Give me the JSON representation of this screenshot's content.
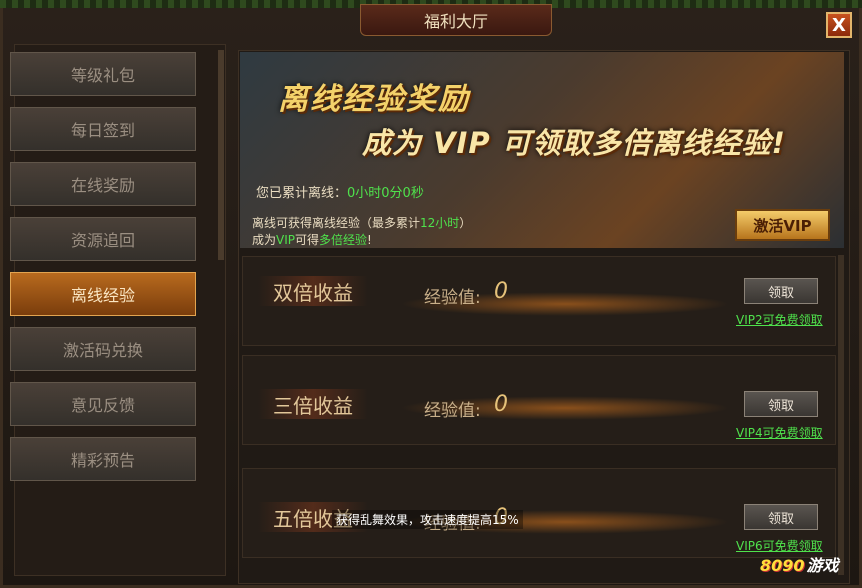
{
  "window": {
    "title": "福利大厅",
    "close_label": "X"
  },
  "sidebar": {
    "items": [
      {
        "label": "等级礼包",
        "active": false
      },
      {
        "label": "每日签到",
        "active": false
      },
      {
        "label": "在线奖励",
        "active": false
      },
      {
        "label": "资源追回",
        "active": false
      },
      {
        "label": "离线经验",
        "active": true
      },
      {
        "label": "激活码兑换",
        "active": false
      },
      {
        "label": "意见反馈",
        "active": false
      },
      {
        "label": "精彩预告",
        "active": false
      }
    ]
  },
  "banner": {
    "title": "离线经验奖励",
    "subtitle": "成为 VIP 可领取多倍离线经验!",
    "offline_label": "您已累计离线：",
    "offline_value": "0小时0分0秒",
    "info1_prefix": "离线可获得离线经验（最多累计",
    "info1_highlight": "12小时",
    "info1_suffix": "）",
    "info2_prefix": "成为",
    "info2_vip": "VIP",
    "info2_mid": "可得",
    "info2_highlight": "多倍经验",
    "info2_suffix": "!",
    "activate_vip_label": "激活VIP"
  },
  "rewards": [
    {
      "label": "双倍收益",
      "exp_label": "经验值:",
      "exp_value": "0",
      "claim_label": "领取",
      "vip_note": "VIP2可免费领取"
    },
    {
      "label": "三倍收益",
      "exp_label": "经验值:",
      "exp_value": "0",
      "claim_label": "领取",
      "vip_note": "VIP4可免费领取"
    },
    {
      "label": "五倍收益",
      "exp_label": "经验值:",
      "exp_value": "0",
      "claim_label": "领取",
      "vip_note": "VIP6可免费领取"
    }
  ],
  "tooltip": "获得乱舞效果，攻击速度提高15%",
  "logo": {
    "numbers": "8090",
    "text": "游戏"
  }
}
